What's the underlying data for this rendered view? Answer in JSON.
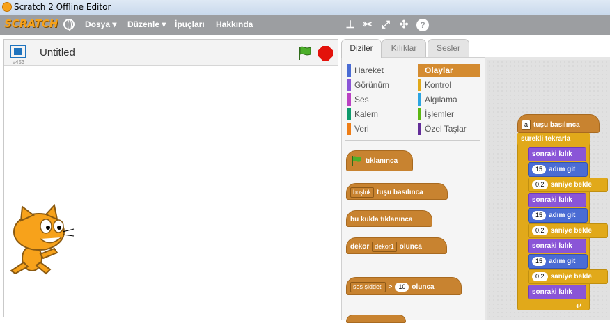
{
  "window": {
    "title": "Scratch 2 Offline Editor"
  },
  "menubar": {
    "logo": "SCRATCH",
    "items": [
      "Dosya ▾",
      "Düzenle ▾",
      "İpuçları",
      "Hakkında"
    ]
  },
  "stage": {
    "version": "v453",
    "project_title": "Untitled"
  },
  "tabs": [
    "Diziler",
    "Kılıklar",
    "Sesler"
  ],
  "categories": {
    "left": [
      "Hareket",
      "Görünüm",
      "Ses",
      "Kalem",
      "Veri"
    ],
    "right": [
      "Olaylar",
      "Kontrol",
      "Algılama",
      "İşlemler",
      "Özel Taşlar"
    ],
    "selected": "Olaylar",
    "colors": {
      "Hareket": "#4a6cd4",
      "Görünüm": "#8a55d7",
      "Ses": "#bb42c3",
      "Kalem": "#0e9a6c",
      "Veri": "#ee7d16",
      "Olaylar": "#c88330",
      "Kontrol": "#e1a91a",
      "Algılama": "#2ca5e2",
      "İşlemler": "#5cb712",
      "Özel Taşlar": "#632d99"
    }
  },
  "palette_blocks": {
    "flag_clicked": "tıklanınca",
    "key_dropdown": "boşluk",
    "key_pressed": "tuşu basılınca",
    "sprite_clicked": "bu kukla tıklanınca",
    "backdrop_label": "dekor",
    "backdrop_dropdown": "dekor1",
    "backdrop_suffix": "olunca",
    "sensor_dropdown": "ses şiddeti",
    "gt": ">",
    "sensor_value": "10",
    "sensor_suffix": "olunca"
  },
  "script": {
    "hat_key": "a",
    "hat_label": "tuşu basılınca",
    "loop_label": "sürekli tekrarla",
    "next_costume": "sonraki kılık",
    "move_steps": "15",
    "move_label": "adım git",
    "wait_value": "0.2",
    "wait_label": "saniye bekle"
  }
}
